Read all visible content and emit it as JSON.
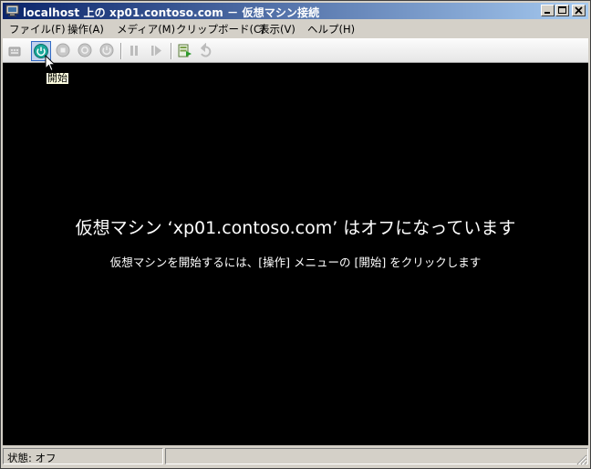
{
  "window": {
    "title": "localhost 上の xp01.contoso.com － 仮想マシン接続",
    "icon": "vm-connect-icon"
  },
  "menubar": {
    "items": [
      {
        "label": "ファイル(F)"
      },
      {
        "label": "操作(A)"
      },
      {
        "label": "メディア(M)"
      },
      {
        "label": "クリップボード(C)"
      },
      {
        "label": "表示(V)"
      },
      {
        "label": "ヘルプ(H)"
      }
    ]
  },
  "toolbar": {
    "buttons": [
      {
        "icon": "ctrl-alt-del-icon",
        "enabled": false
      },
      {
        "icon": "start-power-icon",
        "enabled": true,
        "state": "hovered"
      },
      {
        "icon": "turn-off-icon",
        "enabled": false
      },
      {
        "icon": "shutdown-icon",
        "enabled": false
      },
      {
        "icon": "save-state-icon",
        "enabled": false
      },
      {
        "icon": "pause-icon",
        "enabled": false
      },
      {
        "icon": "resume-icon",
        "enabled": false
      },
      {
        "icon": "snapshot-icon",
        "enabled": true
      },
      {
        "icon": "revert-icon",
        "enabled": false
      }
    ],
    "tooltip": "開始"
  },
  "screen": {
    "headline": "仮想マシン ‘xp01.contoso.com’ はオフになっています",
    "instruction": "仮想マシンを開始するには、[操作] メニューの [開始] をクリックします",
    "background": "#000000"
  },
  "statusbar": {
    "status": "状態: オフ"
  },
  "colors": {
    "titlebar_start": "#0a246a",
    "titlebar_end": "#a6caf0",
    "start_button": "#1aa89a"
  }
}
